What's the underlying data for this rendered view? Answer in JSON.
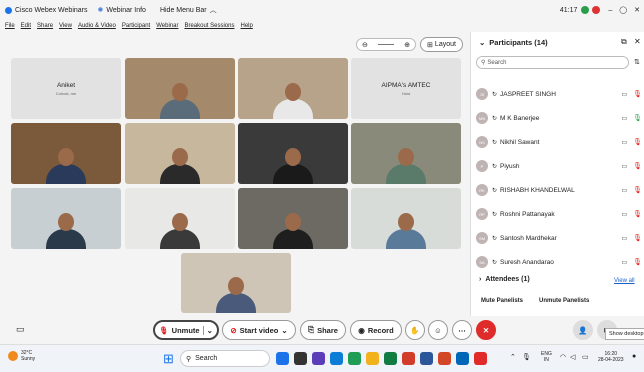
{
  "titlebar": {
    "app": "Cisco Webex Webinars",
    "info": "Webinar Info",
    "hide": "Hide Menu Bar",
    "time": "41:17"
  },
  "menu": [
    "File",
    "Edit",
    "Share",
    "View",
    "Audio & Video",
    "Participant",
    "Webinar",
    "Breakout Sessions",
    "Help"
  ],
  "stage": {
    "layout_label": "Layout",
    "tiles": [
      {
        "name": "Aniket",
        "sub": "Cohost, me"
      },
      {
        "name": "AIPMA's AMTEC",
        "sub": "Host"
      }
    ]
  },
  "panel": {
    "title": "Participants (14)",
    "search_placeholder": "Search",
    "people": [
      {
        "initials": "JS",
        "name": "JASPREET SINGH"
      },
      {
        "initials": "MB",
        "name": "M K Banerjee"
      },
      {
        "initials": "NS",
        "name": "Nikhil Sawant"
      },
      {
        "initials": "P",
        "name": "Piyush"
      },
      {
        "initials": "RK",
        "name": "RISHABH KHANDELWAL"
      },
      {
        "initials": "RP",
        "name": "Roshni Pattanayak"
      },
      {
        "initials": "SM",
        "name": "Santosh Mardhekar"
      },
      {
        "initials": "SA",
        "name": "Suresh Anandarao"
      }
    ],
    "attendees": "Attendees (1)",
    "view_all": "View all",
    "mute_panelists": "Mute Panelists",
    "unmute_panelists": "Unmute Panelists"
  },
  "controls": {
    "unmute": "Unmute",
    "start_video": "Start video",
    "share": "Share",
    "record": "Record",
    "tooltip": "Show desktop"
  },
  "taskbar": {
    "weather_temp": "32°C",
    "weather_desc": "Sunny",
    "search": "Search",
    "lang1": "ENG",
    "lang2": "IN",
    "clock": "16:20",
    "date": "28-04-2023"
  }
}
